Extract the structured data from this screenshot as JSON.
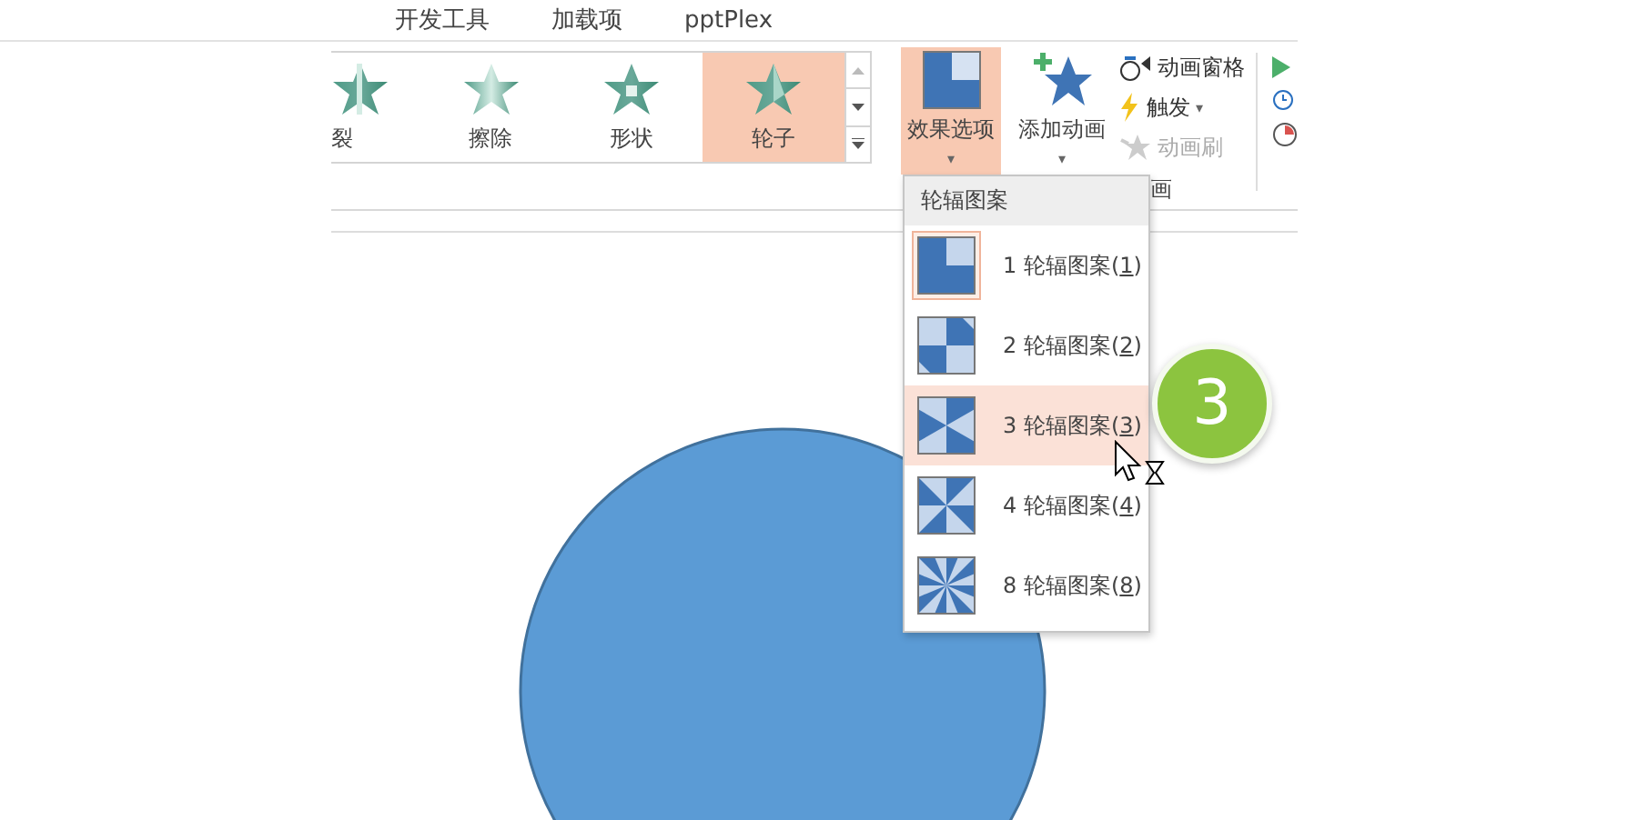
{
  "menu_tabs": [
    "开发工具",
    "加载项",
    "pptPlex"
  ],
  "gallery": {
    "items": [
      {
        "label": "裂",
        "selected": false
      },
      {
        "label": "擦除",
        "selected": false
      },
      {
        "label": "形状",
        "selected": false
      },
      {
        "label": "轮子",
        "selected": true
      }
    ]
  },
  "effect_options": {
    "label": "效果选项",
    "caret": "▾",
    "pressed": true
  },
  "add_animation": {
    "label": "添加动画",
    "caret": "▾"
  },
  "small_buttons": [
    {
      "label": "动画窗格",
      "disabled": false
    },
    {
      "label": "触发",
      "disabled": false,
      "caret": "▾"
    },
    {
      "label": "动画刷",
      "disabled": true
    }
  ],
  "group_label": "画",
  "dropdown": {
    "header": "轮辐图案",
    "items": [
      {
        "text": "1 轮辐图案(",
        "key": "1",
        "tail": ")",
        "selected": true,
        "hovered": false
      },
      {
        "text": "2 轮辐图案(",
        "key": "2",
        "tail": ")",
        "selected": false,
        "hovered": false
      },
      {
        "text": "3 轮辐图案(",
        "key": "3",
        "tail": ")",
        "selected": false,
        "hovered": true
      },
      {
        "text": "4 轮辐图案(",
        "key": "4",
        "tail": ")",
        "selected": false,
        "hovered": false
      },
      {
        "text": "8 轮辐图案(",
        "key": "8",
        "tail": ")",
        "selected": false,
        "hovered": false
      }
    ]
  },
  "step_badge": "3"
}
